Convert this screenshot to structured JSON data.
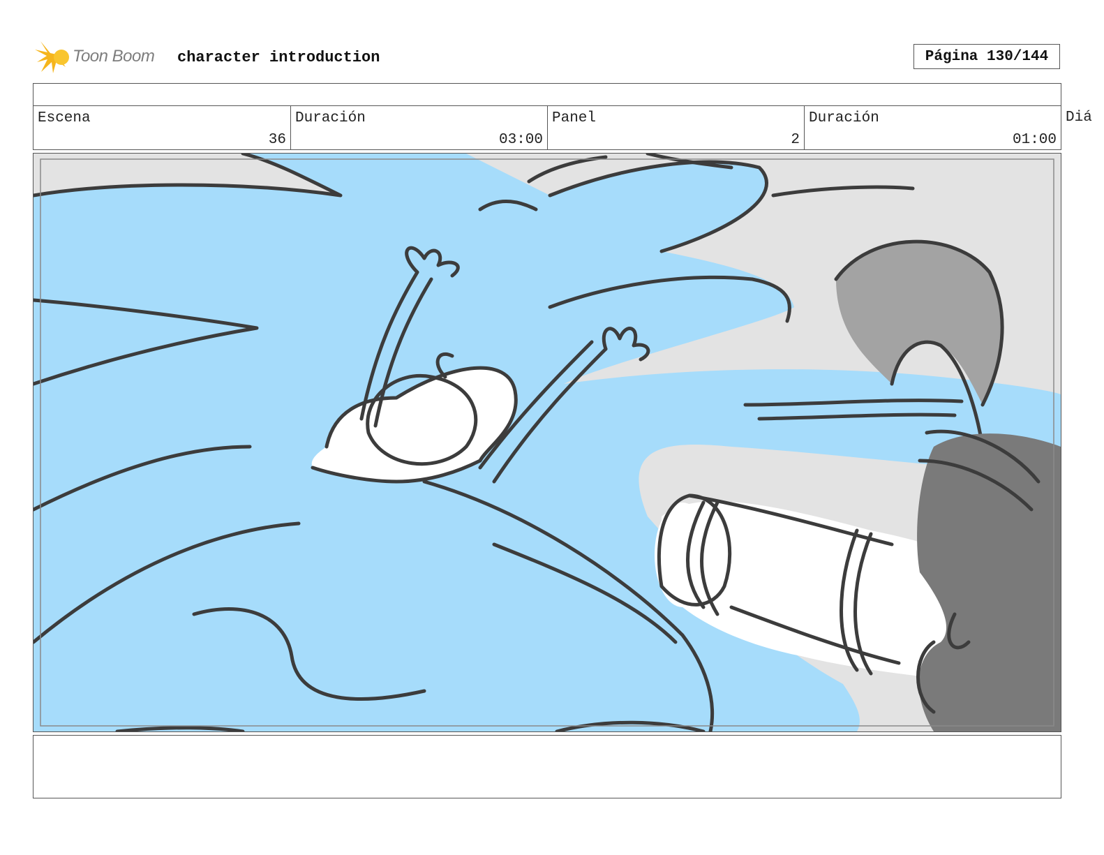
{
  "header": {
    "logo_text": "Toon Boom",
    "title": "character introduction",
    "page_counter": "Página 130/144"
  },
  "info": {
    "scene_label": "Escena",
    "scene_value": "36",
    "scene_duration_label": "Duración",
    "scene_duration_value": "03:00",
    "panel_label": "Panel",
    "panel_value": "2",
    "panel_duration_label": "Duración",
    "panel_duration_value": "01:00",
    "dialogue_label_truncated": "Diá"
  },
  "panel": {
    "colors": {
      "background": "#e3e3e3",
      "splash": "#a6dcfb",
      "line": "#3c3c3c",
      "grey_fill": "#a3a3a3",
      "dark_fill": "#7a7a7a"
    }
  },
  "notes": {
    "text": ""
  }
}
